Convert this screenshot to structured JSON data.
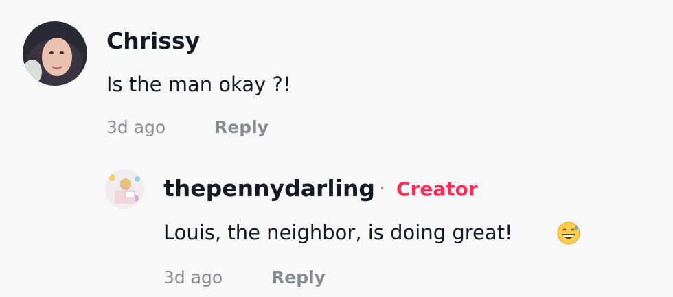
{
  "comments": [
    {
      "username": "Chrissy",
      "text": "Is the man okay ?!",
      "time": "3d ago",
      "reply_label": "Reply",
      "avatar": "user-avatar-photo"
    }
  ],
  "replies": [
    {
      "username": "thepennydarling",
      "separator": "·",
      "badge": "Creator",
      "text": "Louis, the neighbor, is doing great!",
      "emoji": "grinning-sweat-emoji",
      "time": "3d ago",
      "reply_label": "Reply",
      "avatar": "creator-avatar-photo"
    }
  ],
  "colors": {
    "background": "#f8f8f8",
    "text_primary": "#161823",
    "text_secondary": "#8a8b91",
    "creator_badge": "#fe2c55"
  }
}
